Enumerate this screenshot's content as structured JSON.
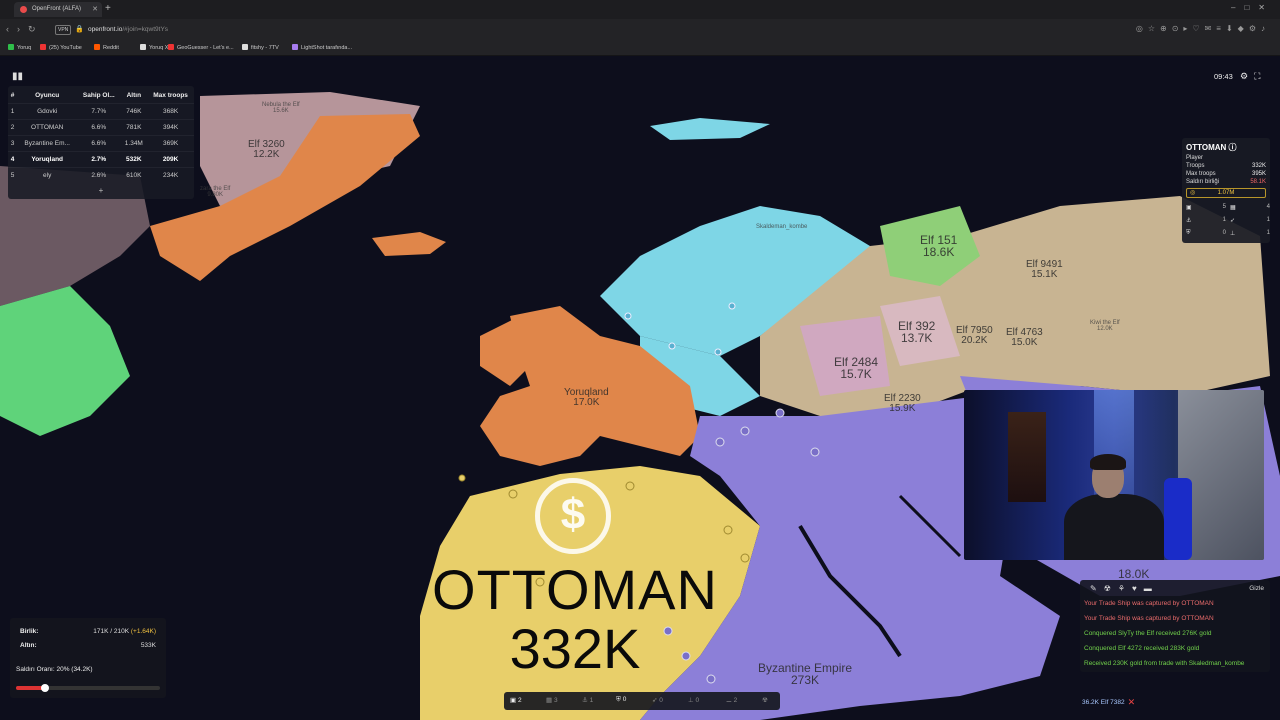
{
  "browser": {
    "tab_title": "OpenFront (ALFA)",
    "url_host": "openfront.io",
    "url_path": "/#join=kqwt9tYs",
    "bookmarks": [
      {
        "label": "Yoruq",
        "color": "#2fbf4a"
      },
      {
        "label": "(25) YouTube",
        "color": "#e33"
      },
      {
        "label": "Reddit",
        "color": "#ff5700"
      },
      {
        "label": "Yoruq X",
        "color": "#ddd"
      },
      {
        "label": "GeoGuesser - Let's e...",
        "color": "#e33"
      },
      {
        "label": "fitshy - 7TV",
        "color": "#ddd"
      },
      {
        "label": "LightShot tarafında...",
        "color": "#a77cf0"
      }
    ]
  },
  "hud": {
    "timer": "09:43"
  },
  "leaderboard": {
    "headers": [
      "#",
      "Oyuncu",
      "Sahip Ol...",
      "Altın",
      "Max troops"
    ],
    "rows": [
      {
        "rank": "1",
        "name": "Gdovki",
        "owned": "7.7%",
        "gold": "746K",
        "troops": "368K"
      },
      {
        "rank": "2",
        "name": "OTTOMAN",
        "owned": "6.6%",
        "gold": "781K",
        "troops": "394K"
      },
      {
        "rank": "3",
        "name": "Byzantine Em...",
        "owned": "6.6%",
        "gold": "1.34M",
        "troops": "369K"
      },
      {
        "rank": "4",
        "name": "Yoruqland",
        "owned": "2.7%",
        "gold": "532K",
        "troops": "209K"
      },
      {
        "rank": "5",
        "name": "ely",
        "owned": "2.6%",
        "gold": "610K",
        "troops": "234K"
      }
    ],
    "expand": "+"
  },
  "player_panel": {
    "name": "OTTOMAN",
    "type": "Player",
    "troops_label": "Troops",
    "troops": "332K",
    "max_troops_label": "Max troops",
    "max_troops": "395K",
    "alliance_label": "Saldırı birliği",
    "alliance": "58.1K",
    "gold": "1.07M",
    "stats": [
      "5",
      "4",
      "1",
      "1",
      "0",
      "1"
    ]
  },
  "map": {
    "labels": [
      {
        "text": "Nebula the Elf\n15.6K",
        "size": "small"
      },
      {
        "text": "Elf 3260\n12.2K",
        "size": "normal"
      },
      {
        "text": "zara the Elf\n9.80K",
        "size": "small"
      },
      {
        "text": "Skaldeman_kombe",
        "size": "small"
      },
      {
        "text": "Elf 151\n18.6K",
        "size": "big"
      },
      {
        "text": "Elf 9491\n15.1K",
        "size": "normal"
      },
      {
        "text": "Elf 392\n13.7K",
        "size": "big"
      },
      {
        "text": "Elf 7950\n20.2K",
        "size": "normal"
      },
      {
        "text": "Elf 4763\n15.0K",
        "size": "normal"
      },
      {
        "text": "Kiwi the Elf\n12.0K",
        "size": "small"
      },
      {
        "text": "Elf 2484\n15.7K",
        "size": "big"
      },
      {
        "text": "Elf 2230\n15.9K",
        "size": "normal"
      },
      {
        "text": "Yoruqland\n17.0K",
        "size": "normal"
      },
      {
        "text": "Byzantine Empire\n273K",
        "size": "big"
      },
      {
        "text": "18.0K",
        "size": "big"
      }
    ],
    "focus_player": "OTTOMAN",
    "focus_troops": "332K",
    "gold_symbol": "$"
  },
  "control_panel": {
    "troops_label": "Birlik:",
    "troops_value": "171K / 210K",
    "troops_inc": "(+1.64K)",
    "gold_label": "Altın:",
    "gold_value": "533K",
    "attack_ratio": "Saldırı Oranı: 20% (34.2K)",
    "slider_fraction": 0.2
  },
  "build_bar": {
    "items": [
      {
        "label": "2",
        "active": true
      },
      {
        "label": "3",
        "active": false
      },
      {
        "label": "1",
        "active": false
      },
      {
        "label": "0",
        "active": true
      },
      {
        "label": "0",
        "active": false
      },
      {
        "label": "0",
        "active": false
      },
      {
        "label": "2",
        "active": false
      }
    ]
  },
  "event_log": {
    "hide": "Gizle",
    "messages": [
      {
        "text": "Your Trade Ship was captured by OTTOMAN",
        "tone": "red"
      },
      {
        "text": "Your Trade Ship was captured by OTTOMAN",
        "tone": "red"
      },
      {
        "text": "Conquered SlyTy the Elf received 276K gold",
        "tone": "green"
      },
      {
        "text": "Conquered Elf 4272 received 283K gold",
        "tone": "green"
      },
      {
        "text": "Received 230K gold from trade with Skaledman_kombe",
        "tone": "green"
      }
    ],
    "attack": "36.2K Elf 7382"
  },
  "colors": {
    "ocean": "#0d0e1c",
    "yoruqland": "#e0864a",
    "ottoman": "#e8cf6a",
    "byzantine": "#8c7fd8",
    "north": "#7ed6e6",
    "east": "#c8b492",
    "green_land": "#5fd37a",
    "elf_pink": "#c9a4a8",
    "accent_red": "#e44",
    "gold": "#f5c842"
  }
}
